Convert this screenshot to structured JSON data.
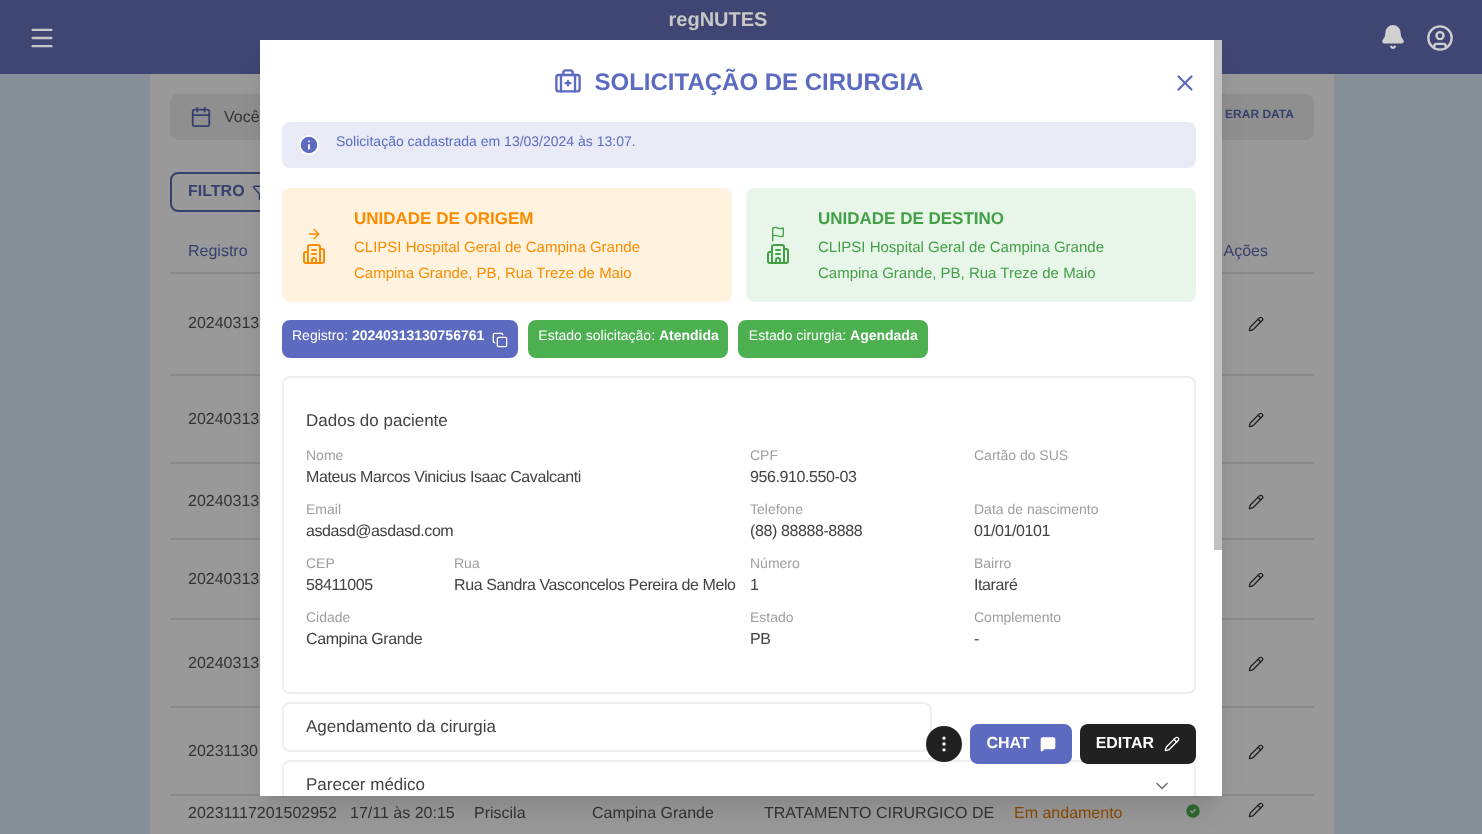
{
  "header": {
    "logo": "regNUTES"
  },
  "date_bar": {
    "text": "Você",
    "button": "ERAR DATA"
  },
  "filter_button": "FILTRO",
  "table": {
    "columns": [
      "Registro",
      "Ações"
    ],
    "rows": [
      {
        "registro": "20240313"
      },
      {
        "registro": "20240313"
      },
      {
        "registro": "20240313"
      },
      {
        "registro": "20240313"
      },
      {
        "registro": "20240313"
      },
      {
        "registro": "20231130"
      },
      {
        "registro": "20231117201502952",
        "date": "17/11 às 20:15",
        "name": "Priscila",
        "city": "Campina Grande",
        "procedure": "TRATAMENTO CIRURGICO DE",
        "status": "Em andamento"
      }
    ]
  },
  "modal": {
    "title": "SOLICITAÇÃO DE CIRURGIA",
    "info": "Solicitação cadastrada em 13/03/2024 às 13:07.",
    "units": [
      {
        "kind": "origin",
        "title": "UNIDADE DE ORIGEM",
        "lines": [
          "CLIPSI Hospital Geral de Campina Grande",
          "Campina Grande, PB, Rua Treze de Maio"
        ]
      },
      {
        "kind": "destination",
        "title": "UNIDADE DE DESTINO",
        "lines": [
          "CLIPSI Hospital Geral de Campina Grande",
          "Campina Grande, PB, Rua Treze de Maio"
        ]
      }
    ],
    "chips": [
      {
        "kind": "registro",
        "text": "Registro: **20240313130756761**"
      },
      {
        "kind": "status",
        "text": "Estado solicitação: **Atendida**"
      },
      {
        "kind": "status",
        "text": "Estado cirurgia: **Agendada**"
      }
    ],
    "patient": {
      "title": "Dados do paciente",
      "rows": [
        [
          {
            "label": "Nome",
            "value": "Mateus Marcos Vinicius Isaac Cavalcanti"
          },
          "",
          {
            "label": "CPF",
            "value": "956.910.550-03"
          },
          {
            "label": "Cartão do SUS"
          }
        ],
        [
          {
            "label": "Email",
            "value": "asdasd@asdasd.com"
          },
          "",
          {
            "label": "Telefone",
            "value": "(88) 88888-8888"
          },
          {
            "label": "Data de nascimento",
            "value": "01/01/0101"
          }
        ],
        [
          {
            "label": "CEP",
            "value": "58411005"
          },
          {
            "label": "Rua",
            "value": "Rua Sandra Vasconcelos Pereira de Melo"
          },
          {
            "label": "Número",
            "value": "1"
          },
          {
            "label": "Bairro",
            "value": "Itararé"
          }
        ],
        [
          {
            "label": "Cidade",
            "value": "Campina Grande"
          },
          "",
          {
            "label": "Estado",
            "value": "PB"
          },
          {
            "label": "Complemento",
            "value": "-"
          }
        ]
      ]
    },
    "sections": [
      {
        "title": "Agendamento da cirurgia",
        "chevron": false
      },
      {
        "title": "Parecer médico",
        "chevron": true
      }
    ],
    "actions": [
      {
        "kind": "more"
      },
      {
        "kind": "chat",
        "label": "CHAT"
      },
      {
        "kind": "edit",
        "label": "EDITAR"
      }
    ]
  }
}
